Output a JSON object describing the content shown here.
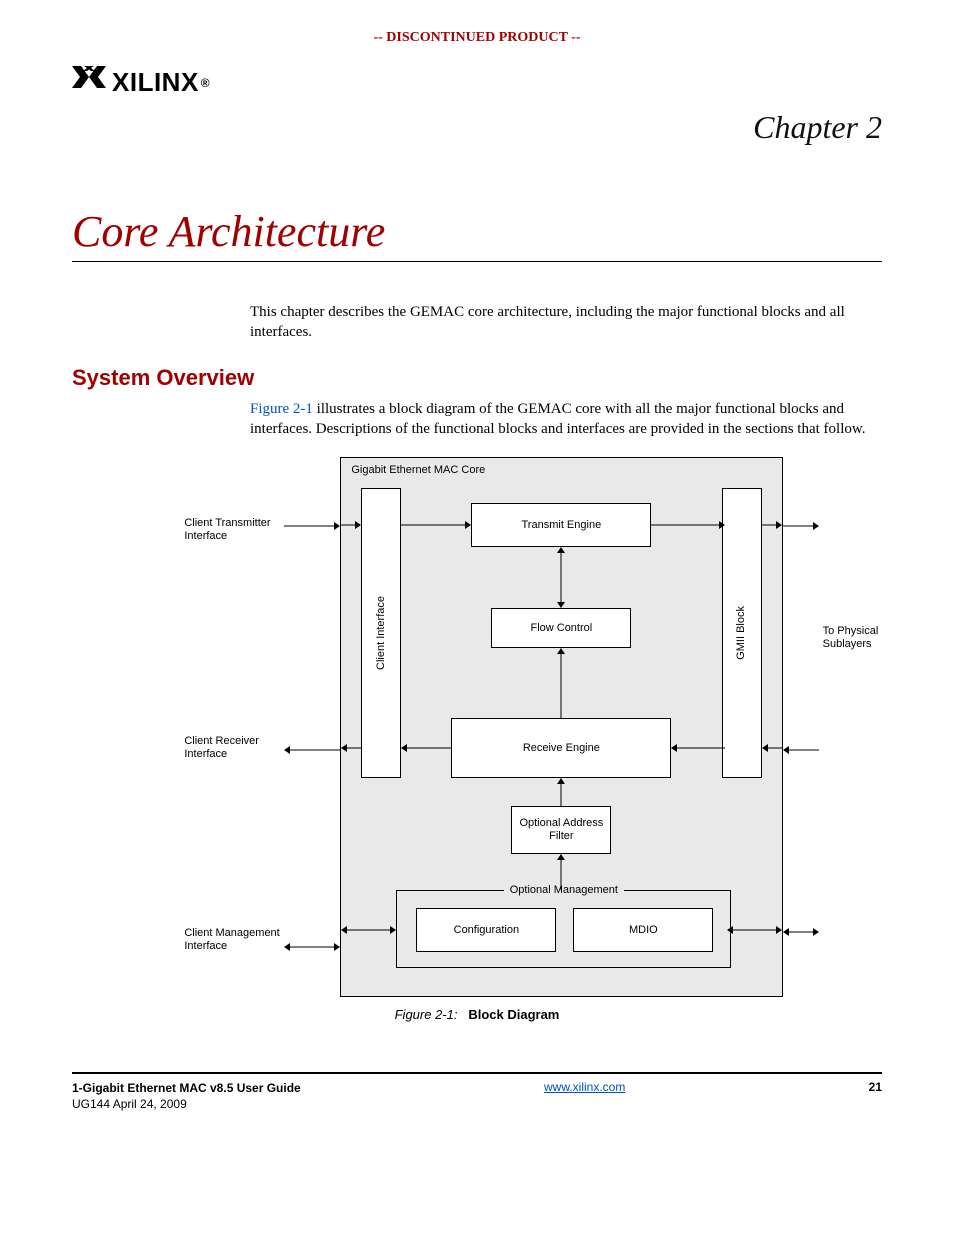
{
  "banner": "-- DISCONTINUED PRODUCT --",
  "logo_text": "XILINX",
  "logo_reg": "®",
  "chapter_label": "Chapter 2",
  "chapter_title": "Core Architecture",
  "intro": "This chapter describes the GEMAC core architecture, including the major functional blocks and all interfaces.",
  "section": "System Overview",
  "overview": {
    "figref": "Figure 2-1",
    "rest": " illustrates a block diagram of the GEMAC core with all the major functional blocks and interfaces. Descriptions of the functional blocks and interfaces are provided in the sections that follow."
  },
  "diagram": {
    "core_title": "Gigabit Ethernet MAC Core",
    "left": {
      "tx": "Client Transmitter Interface",
      "rx": "Client Receiver Interface",
      "mgmt": "Client Management Interface"
    },
    "right": {
      "phy": "To Physical Sublayers"
    },
    "blocks": {
      "client_if": "Client Interface",
      "tx_engine": "Transmit Engine",
      "flow": "Flow Control",
      "rx_engine": "Receive Engine",
      "addr_filter": "Optional Address Filter",
      "gmii": "GMII Block",
      "mgmt_group": "Optional Management",
      "config": "Configuration",
      "mdio": "MDIO"
    }
  },
  "figcap": {
    "pre": "Figure 2-1:",
    "label": "Block Diagram"
  },
  "footer": {
    "title": "1-Gigabit Ethernet MAC v8.5 User Guide",
    "sub": "UG144 April 24, 2009",
    "url": "www.xilinx.com",
    "page": "21"
  }
}
